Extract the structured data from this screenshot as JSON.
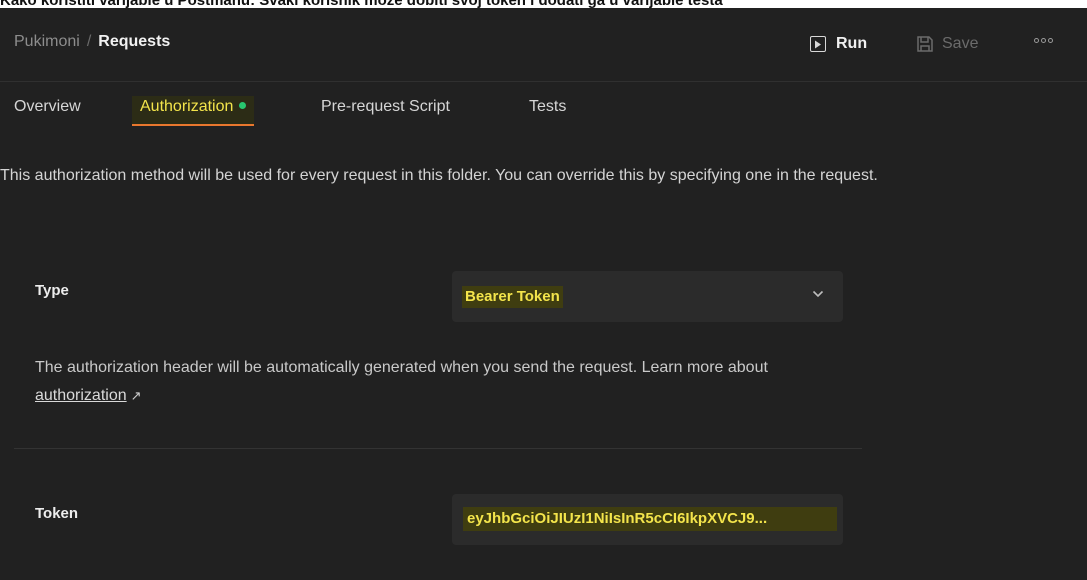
{
  "caption": "Kako koristiti varijable u Postmanu: Svaki korisnik može dobiti svoj token i dodati ga u varijable testa",
  "header": {
    "breadcrumb_parent": "Pukimoni",
    "breadcrumb_separator": "/",
    "breadcrumb_current": "Requests",
    "run_label": "Run",
    "save_label": "Save"
  },
  "tabs": [
    {
      "label": "Overview",
      "active": false
    },
    {
      "label": "Authorization",
      "active": true
    },
    {
      "label": "Pre-request Script",
      "active": false
    },
    {
      "label": "Tests",
      "active": false
    }
  ],
  "description": "This authorization method will be used for every request in this folder. You can override this by specifying one in the request.",
  "auth": {
    "type_label": "Type",
    "type_value": "Bearer Token",
    "helper_text": "The authorization header will be automatically generated when you send the request. Learn more about",
    "helper_link": "authorization",
    "helper_arrow": "↗",
    "token_label": "Token",
    "token_value": "eyJhbGciOiJIUzI1NiIsInR5cCI6IkpXVCJ9..."
  },
  "colors": {
    "background": "#212121",
    "accent_tab": "#f3e44b",
    "tab_underline": "#e8772e",
    "active_dot": "#28c76f"
  },
  "icons": [
    "run-icon",
    "save-icon",
    "more-options-icon",
    "chevron-down-icon"
  ]
}
